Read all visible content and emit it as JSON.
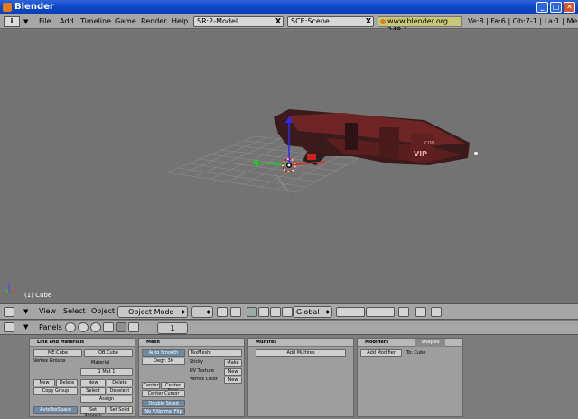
{
  "window": {
    "title": "Blender"
  },
  "header": {
    "info_icon": "i",
    "menus": [
      "File",
      "Add",
      "Timeline",
      "Game",
      "Render",
      "Help"
    ],
    "screen_field": "SR:2-Model",
    "scene_field": "SCE:Scene",
    "site": "www.blender.org 248.1",
    "stats": "Ve:8 | Fa:6 | Ob:7-1 | La:1 | Me"
  },
  "viewport": {
    "object_label": "(1) Cube",
    "texts": {
      "vip": "VIP",
      "cod": "COD"
    }
  },
  "view_header": {
    "menus": [
      "View",
      "Select",
      "Object"
    ],
    "mode": "Object Mode",
    "orientation": "Global"
  },
  "buttons_header": {
    "panels_label": "Panels",
    "frame": "1"
  },
  "panels": {
    "link_materials": {
      "title": "Link and Materials",
      "me_field": "ME:Cube",
      "ob_field": "OB:Cube",
      "vertex_groups": "Vertex Groups",
      "material": "Material",
      "mat_field": "1 Mat 1",
      "new": "New",
      "delete": "Delete",
      "copy_group": "Copy Group",
      "new2": "New",
      "delete2": "Delete",
      "select": "Select",
      "deselect": "Deselect",
      "assign": "Assign",
      "autotexspace": "AutoTexSpace",
      "set_smooth": "Set Smooth",
      "set_solid": "Set Solid"
    },
    "mesh": {
      "title": "Mesh",
      "auto_smooth": "Auto Smooth",
      "degr": "Degr: 30",
      "center": "Center",
      "center_new": "Center New",
      "center_cursor": "Center Cursor",
      "double_sided": "Double Sided",
      "no_vnormal_flip": "No V.Normal Flip",
      "texmesh": "TexMesh:",
      "sticky": "Sticky",
      "uv_texture": "UV Texture",
      "vertex_color": "Vertex Color",
      "make": "Make",
      "new_uv": "New",
      "new_vc": "New"
    },
    "multires": {
      "title": "Multires",
      "add_multires": "Add Multires"
    },
    "modifiers": {
      "title": "Modifiers",
      "shapes_tab": "Shapes",
      "add_modifier": "Add Modifier",
      "to": "To: Cube"
    }
  }
}
